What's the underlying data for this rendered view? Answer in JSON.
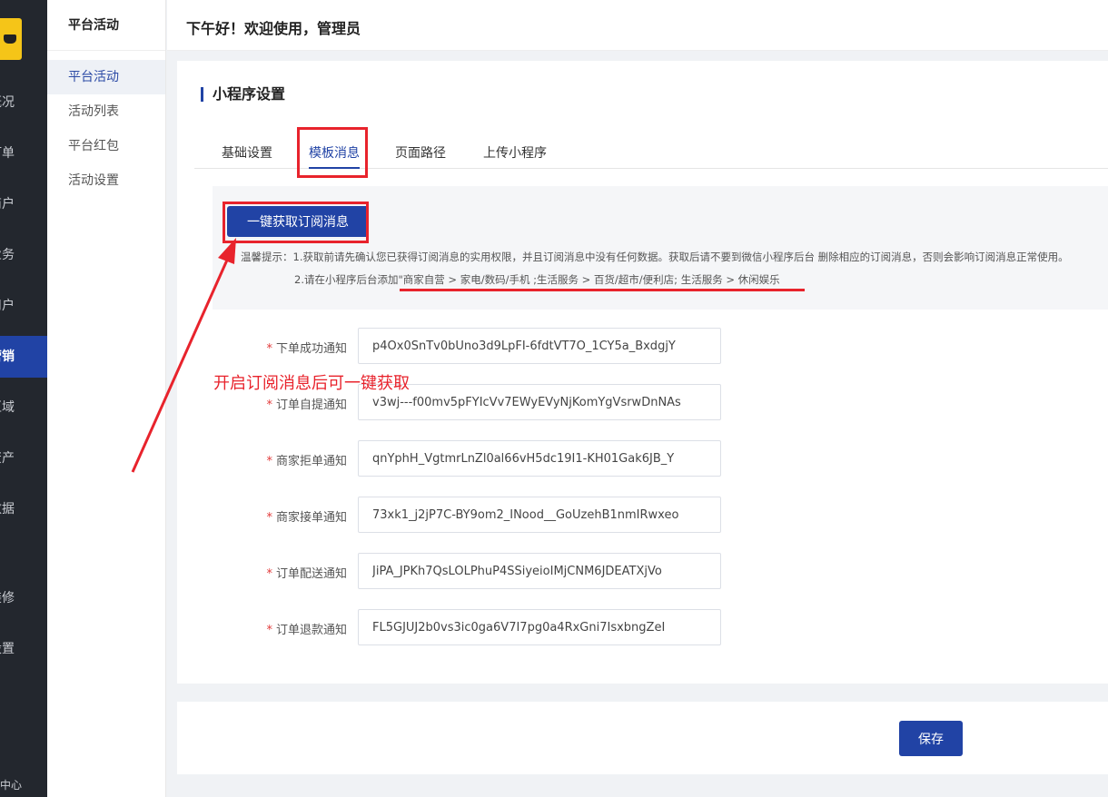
{
  "rail": {
    "items": [
      {
        "label": "概况"
      },
      {
        "label": "订单"
      },
      {
        "label": "商户"
      },
      {
        "label": "业务"
      },
      {
        "label": "用户"
      },
      {
        "label": "营销"
      },
      {
        "label": "区域"
      },
      {
        "label": "资产"
      },
      {
        "label": "数据"
      },
      {
        "label": "装修"
      },
      {
        "label": "设置"
      }
    ],
    "bottom": "截中心",
    "active_index": 5
  },
  "subnav": {
    "title": "平台活动",
    "items": [
      {
        "label": "平台活动"
      },
      {
        "label": "活动列表"
      },
      {
        "label": "平台红包"
      },
      {
        "label": "活动设置"
      }
    ]
  },
  "header": {
    "greeting": "下午好！欢迎使用，管理员"
  },
  "main": {
    "title": "小程序设置",
    "tabs": [
      {
        "label": "基础设置"
      },
      {
        "label": "模板消息"
      },
      {
        "label": "页面路径"
      },
      {
        "label": "上传小程序"
      }
    ],
    "active_tab": 1,
    "fetch_button": "一键获取订阅消息",
    "tip_line1": "温馨提示：1.获取前请先确认您已获得订阅消息的实用权限，并且订阅消息中没有任何数据。获取后请不要到微信小程序后台 删除相应的订阅消息，否则会影响订阅消息正常使用。",
    "tip_line2": "2.请在小程序后台添加\"商家自营 > 家电/数码/手机 ;生活服务 > 百货/超市/便利店; 生活服务 > 休闲娱乐",
    "fields": [
      {
        "label": "下单成功通知",
        "value": "p4Ox0SnTv0bUno3d9LpFI-6fdtVT7O_1CY5a_BxdgjY"
      },
      {
        "label": "订单自提通知",
        "value": "v3wj---f00mv5pFYIcVv7EWyEVyNjKomYgVsrwDnNAs"
      },
      {
        "label": "商家拒单通知",
        "value": "qnYphH_VgtmrLnZl0al66vH5dc19I1-KH01Gak6JB_Y"
      },
      {
        "label": "商家接单通知",
        "value": "73xk1_j2jP7C-BY9om2_INood__GoUzehB1nmIRwxeo"
      },
      {
        "label": "订单配送通知",
        "value": "JiPA_JPKh7QsLOLPhuP4SSiyeioIMjCNM6JDEATXjVo"
      },
      {
        "label": "订单退款通知",
        "value": "FL5GJUJ2b0vs3ic0ga6V7I7pg0a4RxGni7IsxbngZeI"
      }
    ],
    "save_button": "保存"
  },
  "annotation": {
    "text": "开启订阅消息后可一键获取"
  },
  "colors": {
    "primary": "#2143a5",
    "annotation": "#e8232c",
    "rail_bg": "#23272e"
  }
}
